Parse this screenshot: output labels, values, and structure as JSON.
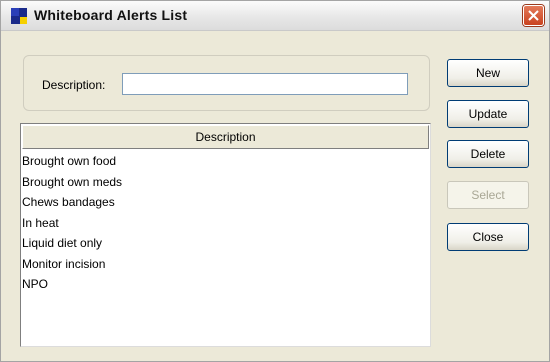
{
  "window": {
    "title": "Whiteboard Alerts List",
    "icon": "app-icon",
    "close_icon": "close-icon"
  },
  "description_field": {
    "label": "Description:",
    "value": ""
  },
  "list": {
    "header": "Description",
    "items": [
      "Brought own food",
      "Brought own meds",
      "Chews bandages",
      "In heat",
      "Liquid diet only",
      "Monitor incision",
      "NPO"
    ]
  },
  "buttons": {
    "new": "New",
    "update": "Update",
    "delete": "Delete",
    "select": "Select",
    "close": "Close"
  },
  "colors": {
    "accent_blue": "#003c74",
    "close_red": "#c9421f",
    "window_bg": "#ece9d8"
  }
}
